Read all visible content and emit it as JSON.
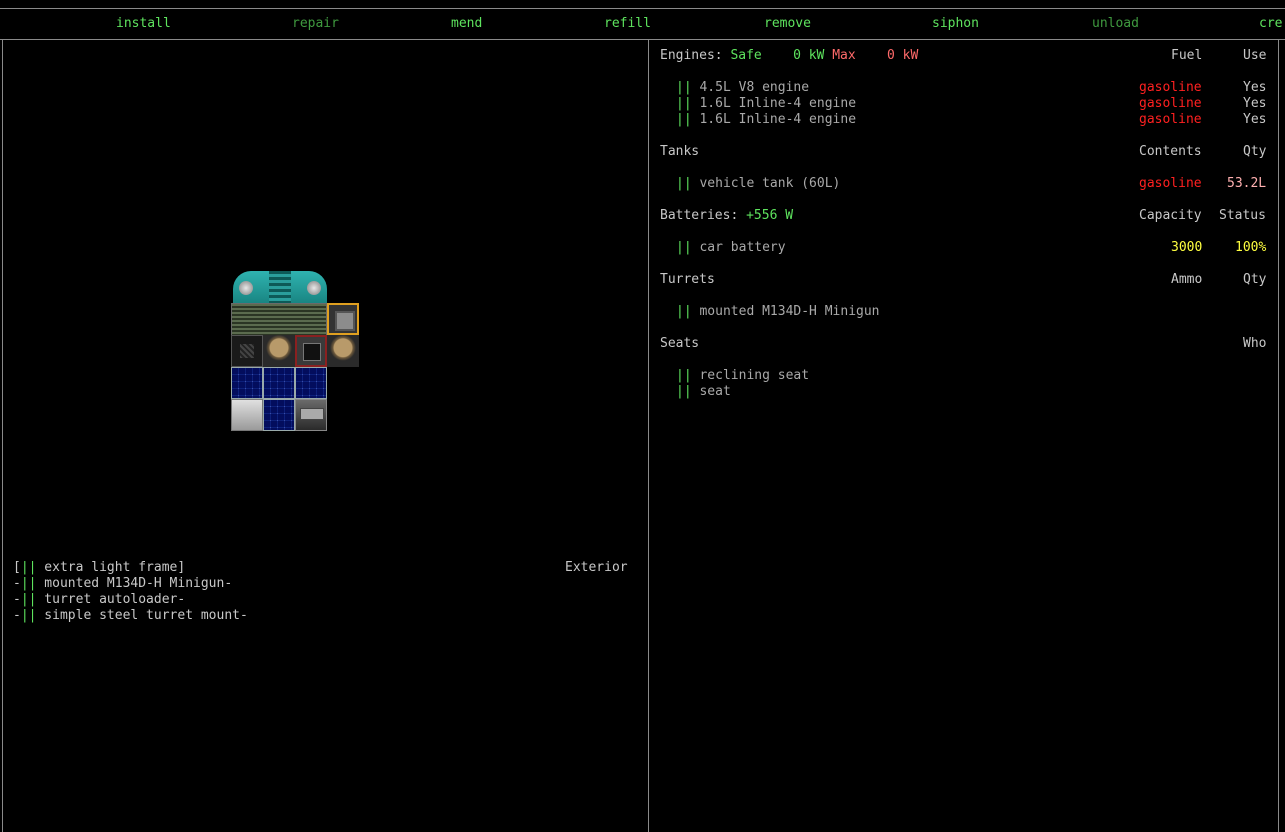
{
  "menu": [
    {
      "label": "install",
      "state": "active"
    },
    {
      "label": "repair",
      "state": "dim"
    },
    {
      "label": "mend",
      "state": "active"
    },
    {
      "label": "refill",
      "state": "active"
    },
    {
      "label": "remove",
      "state": "active"
    },
    {
      "label": "siphon",
      "state": "active"
    },
    {
      "label": "unload",
      "state": "dim"
    },
    {
      "label": "cre",
      "state": "active"
    }
  ],
  "parts_list": {
    "location": "Exterior",
    "items": [
      {
        "prefix": "[",
        "mark": "||",
        "name": " extra light frame]"
      },
      {
        "prefix": "-",
        "mark": "||",
        "name": " mounted M134D-H Minigun-"
      },
      {
        "prefix": "-",
        "mark": "||",
        "name": " turret autoloader-"
      },
      {
        "prefix": "-",
        "mark": "||",
        "name": " simple steel turret mount-"
      }
    ]
  },
  "engines": {
    "label": "Engines:",
    "status": "Safe",
    "power": "0 kW",
    "max_label": "Max",
    "max_power": "0 kW",
    "col_fuel": "Fuel",
    "col_use": "Use",
    "items": [
      {
        "mark": "||",
        "name": "4.5L V8 engine",
        "fuel": "gasoline",
        "use": "Yes"
      },
      {
        "mark": "||",
        "name": "1.6L Inline-4 engine",
        "fuel": "gasoline",
        "use": "Yes"
      },
      {
        "mark": "||",
        "name": "1.6L Inline-4 engine",
        "fuel": "gasoline",
        "use": "Yes"
      }
    ]
  },
  "tanks": {
    "label": "Tanks",
    "col_contents": "Contents",
    "col_qty": "Qty",
    "items": [
      {
        "mark": "||",
        "name": "vehicle tank (60L)",
        "contents": "gasoline",
        "qty": "53.2L"
      }
    ]
  },
  "batteries": {
    "label": "Batteries:",
    "rate": "+556 W",
    "col_capacity": "Capacity",
    "col_status": "Status",
    "items": [
      {
        "mark": "||",
        "name": "car battery",
        "capacity": "3000",
        "status": "100%"
      }
    ]
  },
  "turrets": {
    "label": "Turrets",
    "col_ammo": "Ammo",
    "col_qty": "Qty",
    "items": [
      {
        "mark": "||",
        "name": "mounted M134D-H Minigun"
      }
    ]
  },
  "seats": {
    "label": "Seats",
    "col_who": "Who",
    "items": [
      {
        "mark": "||",
        "name": "reclining seat"
      },
      {
        "mark": "||",
        "name": "seat"
      }
    ]
  },
  "colors": {
    "active": "#5ee35e",
    "dim": "#3f9a3f",
    "fuel": "#ff2020",
    "value": "#ffff40",
    "warn": "#ff6a6a",
    "border": "#8a8a8a"
  }
}
